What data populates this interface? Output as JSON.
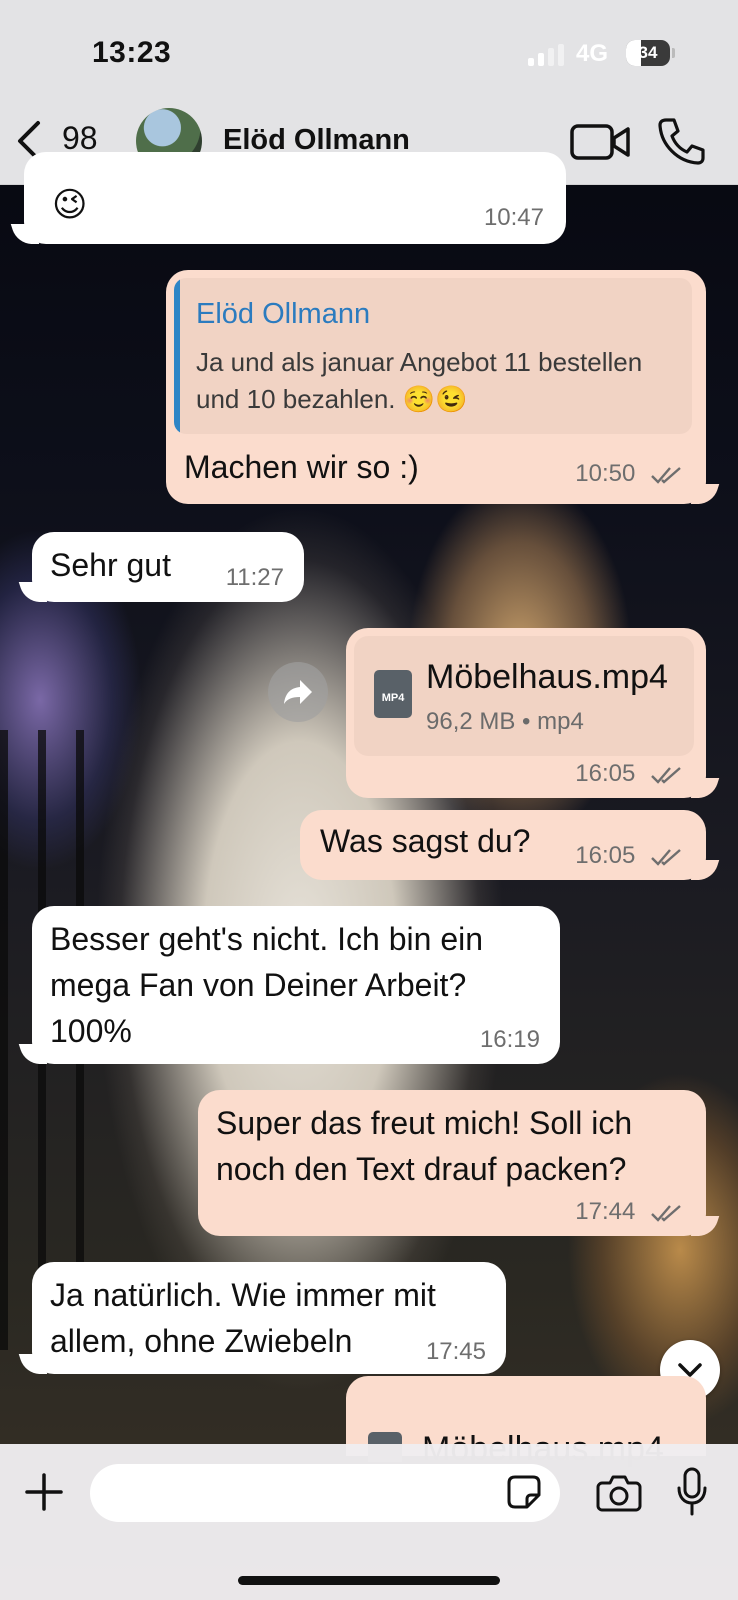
{
  "status_bar": {
    "time": "13:23",
    "network": "4G",
    "battery": "34",
    "battery_level": 0.34
  },
  "header": {
    "back_count": "98",
    "contact_name": "Elöd Ollmann"
  },
  "messages": [
    {
      "dir": "in",
      "text": "😉",
      "time": "10:47"
    },
    {
      "dir": "out",
      "quote_author": "Elöd Ollmann",
      "quote_text": "Ja und als januar Angebot 11 bestellen und 10 bezahlen. ☺️😉",
      "text": "Machen wir so :)",
      "time": "10:50",
      "read": true
    },
    {
      "dir": "in",
      "text": "Sehr gut",
      "time": "11:27"
    },
    {
      "dir": "out",
      "file_name": "Möbelhaus.mp4",
      "file_info": "96,2 MB • mp4",
      "file_badge": "MP4",
      "time": "16:05",
      "read": true
    },
    {
      "dir": "out",
      "text": "Was sagst du?",
      "time": "16:05",
      "read": true
    },
    {
      "dir": "in",
      "text": "Besser geht's nicht. Ich bin ein mega Fan von Deiner Arbeit? 100%",
      "time": "16:19"
    },
    {
      "dir": "out",
      "text": "Super das freut mich! Soll ich noch den Text drauf packen?",
      "time": "17:44",
      "read": true
    },
    {
      "dir": "in",
      "text": "Ja natürlich. Wie immer mit allem, ohne Zwiebeln",
      "time": "17:45"
    },
    {
      "dir": "out",
      "file_name": "Möbelhaus.mp4",
      "partial": true
    }
  ],
  "composer": {
    "input_value": "",
    "placeholder": ""
  },
  "icons": [
    "chevron-left-icon",
    "video-call-icon",
    "phone-icon",
    "forward-icon",
    "file-icon",
    "double-check-icon",
    "chevron-down-icon",
    "plus-icon",
    "sticker-icon",
    "camera-icon",
    "microphone-icon"
  ],
  "colors": {
    "outgoing_bubble": "#fbdccd",
    "incoming_bubble": "#ffffff",
    "quote_accent": "#2e85c6",
    "header_bg": "#ececee"
  }
}
